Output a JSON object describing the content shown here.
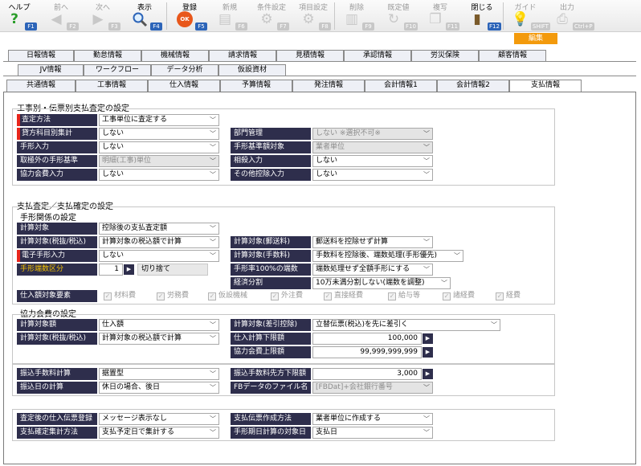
{
  "toolbar": {
    "help": {
      "label": "ヘルプ",
      "fkey": "F1"
    },
    "prev": {
      "label": "前へ",
      "fkey": "F2"
    },
    "next": {
      "label": "次へ",
      "fkey": "F3"
    },
    "view": {
      "label": "表示",
      "fkey": "F4"
    },
    "register": {
      "label": "登録",
      "fkey": "F5",
      "icon_text": "OK"
    },
    "new": {
      "label": "新規",
      "fkey": "F6"
    },
    "condition": {
      "label": "条件設定",
      "fkey": "F7"
    },
    "item_setting": {
      "label": "項目設定",
      "fkey": "F8"
    },
    "delete": {
      "label": "削除",
      "fkey": "F9"
    },
    "default": {
      "label": "既定値",
      "fkey": "F10"
    },
    "copy": {
      "label": "複写",
      "fkey": "F11"
    },
    "close": {
      "label": "閉じる",
      "fkey": "F12"
    },
    "guide": {
      "label": "ガイド",
      "fkey": "SHIFT"
    },
    "output": {
      "label": "出力",
      "fkey": "Ctrl+P"
    }
  },
  "mode_tab": "編集",
  "tabs_row1": [
    "日報情報",
    "勤怠情報",
    "機械情報",
    "請求情報",
    "見積情報",
    "承認情報",
    "労災保険",
    "顧客情報"
  ],
  "tabs_row2": [
    "JV情報",
    "ワークフロー",
    "データ分析",
    "仮設資材"
  ],
  "tabs_row3": [
    "共通情報",
    "工事情報",
    "仕入情報",
    "予算情報",
    "発注情報",
    "会計情報1",
    "会計情報2",
    "支払情報"
  ],
  "sec1": {
    "title": "工事別・伝票別支払査定の設定",
    "assess_method": {
      "label": "査定方法",
      "value": "工事単位に査定する"
    },
    "account_summary": {
      "label": "貸方科目別集計",
      "value": "しない"
    },
    "dept_mgmt": {
      "label": "部門管理",
      "value": "しない ※選択不可※"
    },
    "bill_input": {
      "label": "手形入力",
      "value": "しない"
    },
    "bill_base_target": {
      "label": "手形基準額対象",
      "value": "業者単位"
    },
    "non_bill_base": {
      "label": "取極外の手形基準",
      "value": "明細(工事)単位"
    },
    "offset_input": {
      "label": "相殺入力",
      "value": "しない"
    },
    "coop_fee_input": {
      "label": "協力会費入力",
      "value": "しない"
    },
    "other_deduction": {
      "label": "その他控除入力",
      "value": "しない"
    }
  },
  "sec2": {
    "title": "支払査定／支払確定の設定",
    "sub_bill": "手形関係の設定",
    "calc_target": {
      "label": "計算対象",
      "value": "控除後の支払査定額"
    },
    "calc_target_tax": {
      "label": "計算対象(税抜/税込)",
      "value": "計算対象の税込額で計算"
    },
    "calc_target_postage": {
      "label": "計算対象(郵送料)",
      "value": "郵送料を控除せず計算"
    },
    "e_bill_input": {
      "label": "電子手形入力",
      "value": "しない"
    },
    "calc_target_fee": {
      "label": "計算対象(手数料)",
      "value": "手数料を控除後、端数処理(手形優先)"
    },
    "bill_fraction": {
      "label": "手形端数区分",
      "value": "1",
      "desc": "切り捨て"
    },
    "bill_rate_fraction": {
      "label": "手形率100%の端数",
      "value": "端数処理せず全額手形にする"
    },
    "economic_split": {
      "label": "経済分割",
      "value": "10万未満分割しない(端数を調整)"
    },
    "purchase_elements": {
      "label": "仕入額対象要素",
      "items": [
        "材料費",
        "労務費",
        "仮設機械",
        "外注費",
        "直接経費",
        "給与等",
        "諸経費",
        "経費"
      ]
    }
  },
  "sec3": {
    "title": "協力会費の設定",
    "calc_amount": {
      "label": "計算対象額",
      "value": "仕入額"
    },
    "calc_target_deduction": {
      "label": "計算対象(差引控除)",
      "value": "立替伝票(税込)を先に差引く"
    },
    "calc_target_tax": {
      "label": "計算対象(税抜/税込)",
      "value": "計算対象の税込額で計算"
    },
    "purchase_min": {
      "label": "仕入計算下限額",
      "value": "100,000"
    },
    "coop_max": {
      "label": "協力会費上限額",
      "value": "99,999,999,999"
    }
  },
  "sec4": {
    "transfer_fee_calc": {
      "label": "振込手数料計算",
      "value": "据置型"
    },
    "transfer_fee_min": {
      "label": "振込手数料先方下限額",
      "value": "3,000"
    },
    "transfer_date_calc": {
      "label": "振込日の計算",
      "value": "休日の場合、後日"
    },
    "fb_file_name": {
      "label": "FBデータのファイル名",
      "value": "[FBDat]+会社銀行番号"
    }
  },
  "sec5": {
    "post_assess_purchase": {
      "label": "査定後の仕入伝票登録",
      "value": "メッセージ表示なし"
    },
    "pay_slip_method": {
      "label": "支払伝票作成方法",
      "value": "業者単位に作成する"
    },
    "pay_confirm_method": {
      "label": "支払確定集計方法",
      "value": "支払予定日で集計する"
    },
    "bill_due_date_target": {
      "label": "手形期日計算の対象日",
      "value": "支払日"
    }
  }
}
